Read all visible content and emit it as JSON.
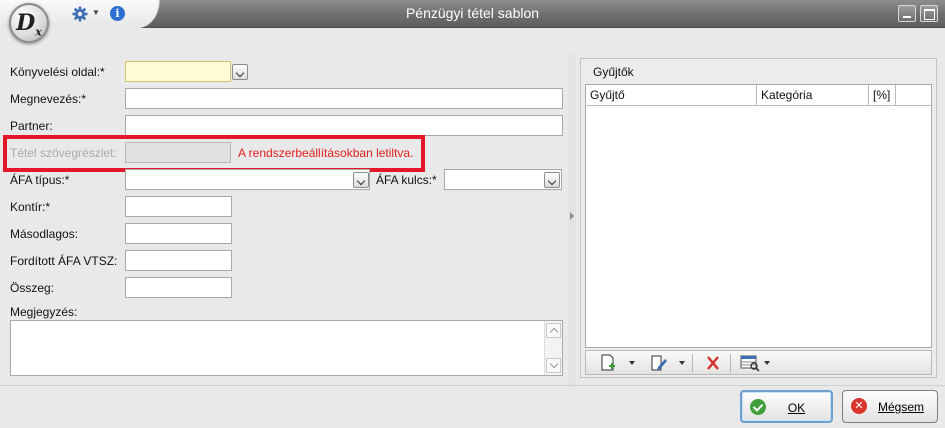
{
  "window": {
    "title": "Pénzügyi tétel sablon",
    "logo_text": "D",
    "logo_sub": "x"
  },
  "form": {
    "konyvelesi_oldal": {
      "label": "Könyvelési oldal:*",
      "value": ""
    },
    "megnevezes": {
      "label": "Megnevezés:*",
      "value": ""
    },
    "partner": {
      "label": "Partner:",
      "value": ""
    },
    "tetel_szovegreszlet": {
      "label": "Tétel szövegrészlet:",
      "value": "",
      "disabled": true
    },
    "disabled_message": "A rendszerbeállításokban letiltva.",
    "afa_tipus": {
      "label": "ÁFA típus:*",
      "value": ""
    },
    "afa_kulcs": {
      "label": "ÁFA kulcs:*",
      "value": ""
    },
    "kontir": {
      "label": "Kontír:*",
      "value": ""
    },
    "masodlagos": {
      "label": "Másodlagos:",
      "value": ""
    },
    "forditott_afa_vtsz": {
      "label": "Fordított ÁFA VTSZ:",
      "value": ""
    },
    "osszeg": {
      "label": "Összeg:",
      "value": ""
    },
    "megjegyzes": {
      "label": "Megjegyzés:",
      "value": ""
    }
  },
  "gyujtok": {
    "title": "Gyűjtők",
    "columns": [
      "Gyűjtő",
      "Kategória",
      "[%]"
    ],
    "rows": [],
    "toolbar": [
      "new-icon",
      "edit-icon",
      "delete-icon",
      "grid-view-icon"
    ]
  },
  "buttons": {
    "ok": "OK",
    "cancel": "Mégsem"
  },
  "colors": {
    "highlight_frame": "#e4172a",
    "warning_text": "#e02020",
    "required_field_bg": "#fffbd6"
  }
}
